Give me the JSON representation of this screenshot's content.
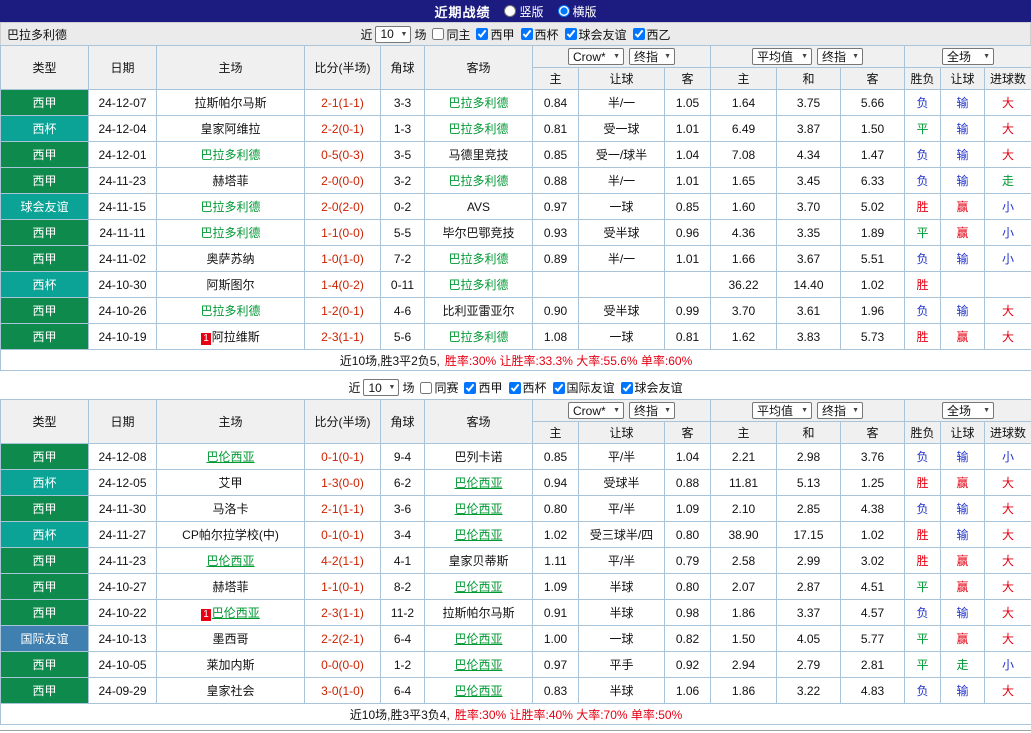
{
  "topbar": {
    "title": "近期战绩",
    "layout_options": [
      {
        "label": "竖版",
        "selected": false
      },
      {
        "label": "横版",
        "selected": true
      }
    ]
  },
  "colors": {
    "topbar_bg": "#1b1b80",
    "table_border": "#a9c3d9",
    "header_bg": "#f0f0f0",
    "section_bar_bg": "#ebebeb",
    "focus_team": "#009933",
    "score": "#cc2200",
    "badge_bg": "#e60012",
    "summary": "#e60012",
    "type_colors": {
      "西甲": "#0e8a4d",
      "西杯": "#0aa396",
      "球会友谊": "#0aa396",
      "国际友谊": "#4080b0",
      "西乙": "#0e8a4d"
    },
    "result_colors": {
      "胜": "#e60012",
      "赢": "#e60012",
      "大": "#e60012",
      "负": "#2233cc",
      "输": "#2233cc",
      "小": "#2233cc",
      "平": "#009933",
      "走": "#009933"
    }
  },
  "table_header": {
    "static_cols": [
      "类型",
      "日期",
      "主场",
      "比分(半场)",
      "角球",
      "客场"
    ],
    "odds_group": {
      "dropdowns": [
        "Crow*",
        "终指"
      ],
      "cols": [
        "主",
        "让球",
        "客"
      ]
    },
    "avg_group": {
      "dropdowns": [
        "平均值",
        "终指"
      ],
      "cols": [
        "主",
        "和",
        "客"
      ]
    },
    "full_group": {
      "dropdown": "全场",
      "cols": [
        "胜负",
        "让球",
        "进球数"
      ]
    }
  },
  "sections": [
    {
      "team": "巴拉多利德",
      "focus_underline": false,
      "filter": {
        "near_label": "近",
        "games_value": "10",
        "games_suffix": "场",
        "same_label": "同主",
        "same_checked": false,
        "leagues": [
          {
            "label": "西甲",
            "checked": true
          },
          {
            "label": "西杯",
            "checked": true
          },
          {
            "label": "球会友谊",
            "checked": true
          },
          {
            "label": "西乙",
            "checked": true
          }
        ]
      },
      "rows": [
        {
          "type": "西甲",
          "date": "24-12-07",
          "home": "拉斯帕尔马斯",
          "score": "2-1(1-1)",
          "corner": "3-3",
          "away": "巴拉多利德",
          "away_focus": true,
          "odds": [
            "0.84",
            "半/一",
            "1.05"
          ],
          "avg": [
            "1.64",
            "3.75",
            "5.66"
          ],
          "results": [
            "负",
            "输",
            "大"
          ]
        },
        {
          "type": "西杯",
          "date": "24-12-04",
          "home": "皇家阿维拉",
          "score": "2-2(0-1)",
          "corner": "1-3",
          "away": "巴拉多利德",
          "away_focus": true,
          "odds": [
            "0.81",
            "受一球",
            "1.01"
          ],
          "avg": [
            "6.49",
            "3.87",
            "1.50"
          ],
          "results": [
            "平",
            "输",
            "大"
          ]
        },
        {
          "type": "西甲",
          "date": "24-12-01",
          "home": "巴拉多利德",
          "home_focus": true,
          "score": "0-5(0-3)",
          "corner": "3-5",
          "away": "马德里竞技",
          "odds": [
            "0.85",
            "受一/球半",
            "1.04"
          ],
          "avg": [
            "7.08",
            "4.34",
            "1.47"
          ],
          "results": [
            "负",
            "输",
            "大"
          ]
        },
        {
          "type": "西甲",
          "date": "24-11-23",
          "home": "赫塔菲",
          "score": "2-0(0-0)",
          "corner": "3-2",
          "away": "巴拉多利德",
          "away_focus": true,
          "odds": [
            "0.88",
            "半/一",
            "1.01"
          ],
          "avg": [
            "1.65",
            "3.45",
            "6.33"
          ],
          "results": [
            "负",
            "输",
            "走"
          ]
        },
        {
          "type": "球会友谊",
          "date": "24-11-15",
          "home": "巴拉多利德",
          "home_focus": true,
          "score": "2-0(2-0)",
          "corner": "0-2",
          "away": "AVS",
          "odds": [
            "0.97",
            "一球",
            "0.85"
          ],
          "avg": [
            "1.60",
            "3.70",
            "5.02"
          ],
          "results": [
            "胜",
            "赢",
            "小"
          ]
        },
        {
          "type": "西甲",
          "date": "24-11-11",
          "home": "巴拉多利德",
          "home_focus": true,
          "score": "1-1(0-0)",
          "corner": "5-5",
          "away": "毕尔巴鄂竞技",
          "odds": [
            "0.93",
            "受半球",
            "0.96"
          ],
          "avg": [
            "4.36",
            "3.35",
            "1.89"
          ],
          "results": [
            "平",
            "赢",
            "小"
          ]
        },
        {
          "type": "西甲",
          "date": "24-11-02",
          "home": "奥萨苏纳",
          "score": "1-0(1-0)",
          "corner": "7-2",
          "away": "巴拉多利德",
          "away_focus": true,
          "odds": [
            "0.89",
            "半/一",
            "1.01"
          ],
          "avg": [
            "1.66",
            "3.67",
            "5.51"
          ],
          "results": [
            "负",
            "输",
            "小"
          ]
        },
        {
          "type": "西杯",
          "date": "24-10-30",
          "home": "阿斯图尔",
          "score": "1-4(0-2)",
          "corner": "0-11",
          "away": "巴拉多利德",
          "away_focus": true,
          "odds": [
            "",
            "",
            ""
          ],
          "avg": [
            "36.22",
            "14.40",
            "1.02"
          ],
          "results": [
            "胜",
            "",
            ""
          ]
        },
        {
          "type": "西甲",
          "date": "24-10-26",
          "home": "巴拉多利德",
          "home_focus": true,
          "score": "1-2(0-1)",
          "corner": "4-6",
          "away": "比利亚雷亚尔",
          "odds": [
            "0.90",
            "受半球",
            "0.99"
          ],
          "avg": [
            "3.70",
            "3.61",
            "1.96"
          ],
          "results": [
            "负",
            "输",
            "大"
          ]
        },
        {
          "type": "西甲",
          "date": "24-10-19",
          "home": "阿拉维斯",
          "home_badge": "1",
          "score": "2-3(1-1)",
          "corner": "5-6",
          "away": "巴拉多利德",
          "away_focus": true,
          "odds": [
            "1.08",
            "一球",
            "0.81"
          ],
          "avg": [
            "1.62",
            "3.83",
            "5.73"
          ],
          "results": [
            "胜",
            "赢",
            "大"
          ]
        }
      ],
      "summary": {
        "prefix": "近10场,胜3平2负5,",
        "stats": "胜率:30% 让胜率:33.3% 大率:55.6% 单率:60%"
      }
    },
    {
      "team": "",
      "focus_underline": true,
      "filter": {
        "near_label": "近",
        "games_value": "10",
        "games_suffix": "场",
        "same_label": "同赛",
        "same_checked": false,
        "leagues": [
          {
            "label": "西甲",
            "checked": true
          },
          {
            "label": "西杯",
            "checked": true
          },
          {
            "label": "国际友谊",
            "checked": true
          },
          {
            "label": "球会友谊",
            "checked": true
          }
        ]
      },
      "rows": [
        {
          "type": "西甲",
          "date": "24-12-08",
          "home": "巴伦西亚",
          "home_focus": true,
          "score": "0-1(0-1)",
          "corner": "9-4",
          "away": "巴列卡诺",
          "odds": [
            "0.85",
            "平/半",
            "1.04"
          ],
          "avg": [
            "2.21",
            "2.98",
            "3.76"
          ],
          "results": [
            "负",
            "输",
            "小"
          ]
        },
        {
          "type": "西杯",
          "date": "24-12-05",
          "home": "艾甲",
          "score": "1-3(0-0)",
          "corner": "6-2",
          "away": "巴伦西亚",
          "away_focus": true,
          "odds": [
            "0.94",
            "受球半",
            "0.88"
          ],
          "avg": [
            "11.81",
            "5.13",
            "1.25"
          ],
          "results": [
            "胜",
            "赢",
            "大"
          ]
        },
        {
          "type": "西甲",
          "date": "24-11-30",
          "home": "马洛卡",
          "score": "2-1(1-1)",
          "corner": "3-6",
          "away": "巴伦西亚",
          "away_focus": true,
          "odds": [
            "0.80",
            "平/半",
            "1.09"
          ],
          "avg": [
            "2.10",
            "2.85",
            "4.38"
          ],
          "results": [
            "负",
            "输",
            "大"
          ]
        },
        {
          "type": "西杯",
          "date": "24-11-27",
          "home": "CP帕尔拉学校(中)",
          "score": "0-1(0-1)",
          "corner": "3-4",
          "away": "巴伦西亚",
          "away_focus": true,
          "odds": [
            "1.02",
            "受三球半/四",
            "0.80"
          ],
          "avg": [
            "38.90",
            "17.15",
            "1.02"
          ],
          "results": [
            "胜",
            "输",
            "大"
          ]
        },
        {
          "type": "西甲",
          "date": "24-11-23",
          "home": "巴伦西亚",
          "home_focus": true,
          "score": "4-2(1-1)",
          "corner": "4-1",
          "away": "皇家贝蒂斯",
          "odds": [
            "1.11",
            "平/半",
            "0.79"
          ],
          "avg": [
            "2.58",
            "2.99",
            "3.02"
          ],
          "results": [
            "胜",
            "赢",
            "大"
          ]
        },
        {
          "type": "西甲",
          "date": "24-10-27",
          "home": "赫塔菲",
          "score": "1-1(0-1)",
          "corner": "8-2",
          "away": "巴伦西亚",
          "away_focus": true,
          "odds": [
            "1.09",
            "半球",
            "0.80"
          ],
          "avg": [
            "2.07",
            "2.87",
            "4.51"
          ],
          "results": [
            "平",
            "赢",
            "大"
          ]
        },
        {
          "type": "西甲",
          "date": "24-10-22",
          "home": "巴伦西亚",
          "home_focus": true,
          "home_badge": "1",
          "score": "2-3(1-1)",
          "corner": "11-2",
          "away": "拉斯帕尔马斯",
          "odds": [
            "0.91",
            "半球",
            "0.98"
          ],
          "avg": [
            "1.86",
            "3.37",
            "4.57"
          ],
          "results": [
            "负",
            "输",
            "大"
          ]
        },
        {
          "type": "国际友谊",
          "date": "24-10-13",
          "home": "墨西哥",
          "score": "2-2(2-1)",
          "corner": "6-4",
          "away": "巴伦西亚",
          "away_focus": true,
          "odds": [
            "1.00",
            "一球",
            "0.82"
          ],
          "avg": [
            "1.50",
            "4.05",
            "5.77"
          ],
          "results": [
            "平",
            "赢",
            "大"
          ]
        },
        {
          "type": "西甲",
          "date": "24-10-05",
          "home": "莱加内斯",
          "score": "0-0(0-0)",
          "corner": "1-2",
          "away": "巴伦西亚",
          "away_focus": true,
          "odds": [
            "0.97",
            "平手",
            "0.92"
          ],
          "avg": [
            "2.94",
            "2.79",
            "2.81"
          ],
          "results": [
            "平",
            "走",
            "小"
          ]
        },
        {
          "type": "西甲",
          "date": "24-09-29",
          "home": "皇家社会",
          "score": "3-0(1-0)",
          "corner": "6-4",
          "away": "巴伦西亚",
          "away_focus": true,
          "odds": [
            "0.83",
            "半球",
            "1.06"
          ],
          "avg": [
            "1.86",
            "3.22",
            "4.83"
          ],
          "results": [
            "负",
            "输",
            "大"
          ]
        }
      ],
      "summary": {
        "prefix": "近10场,胜3平3负4,",
        "stats": "胜率:30% 让胜率:40% 大率:70% 单率:50%"
      }
    }
  ]
}
